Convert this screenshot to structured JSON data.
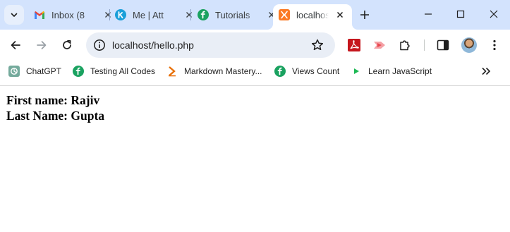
{
  "browser": {
    "tabs": [
      {
        "title": "Inbox (8",
        "icon": "gmail-icon"
      },
      {
        "title": "Me | Att",
        "icon": "k-logo-icon"
      },
      {
        "title": "Tutorials",
        "icon": "tutorials-logo-icon"
      },
      {
        "title": "localhost",
        "icon": "xampp-icon",
        "active": true
      }
    ],
    "url": "localhost/hello.php",
    "bookmarks": [
      {
        "label": "ChatGPT",
        "icon": "chatgpt-icon"
      },
      {
        "label": "Testing All Codes",
        "icon": "tutorials-logo-icon"
      },
      {
        "label": "Markdown Mastery...",
        "icon": "chevron-logo-icon"
      },
      {
        "label": "Views Count",
        "icon": "tutorials-logo-icon"
      },
      {
        "label": "Learn JavaScript",
        "icon": "play-icon"
      }
    ]
  },
  "colors": {
    "tabstrip": "#d3e3fd",
    "omnibox": "#e9eef6",
    "tutorials_green": "#1aa260",
    "xampp_orange": "#fb7a24"
  },
  "content": {
    "first_line": "First name: Rajiv",
    "second_line": "Last Name: Gupta"
  }
}
